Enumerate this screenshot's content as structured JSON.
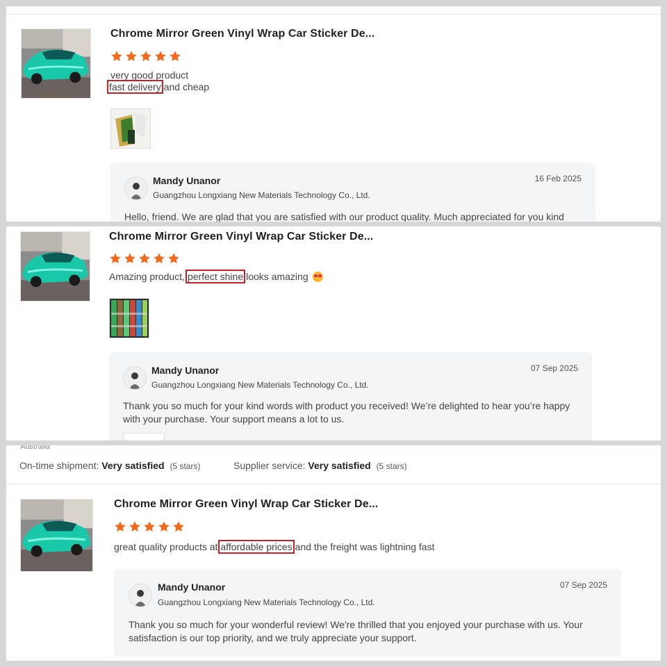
{
  "product_title": "Chrome Mirror Green Vinyl Wrap Car Sticker De...",
  "star_color": "#f26b1d",
  "highlight_color": "#c8202a",
  "reviews": [
    {
      "text_line1": "very good product",
      "text_highlight": "fast delivery",
      "text_after": "and cheap",
      "reply": {
        "name": "Mandy Unanor",
        "company": "Guangzhou Longxiang New Materials Technology Co., Ltd.",
        "date": "16 Feb 2025",
        "message": "Hello, friend. We are glad that you are satisfied with our product quality. Much appreciated for you kind"
      }
    },
    {
      "text_before": "Amazing product,",
      "text_highlight": "perfect shine",
      "text_after": "looks amazing",
      "emoji": "heart-eyes-emoji",
      "reply": {
        "name": "Mandy Unanor",
        "company": "Guangzhou Longxiang New Materials Technology Co., Ltd.",
        "date": "07 Sep 2025",
        "message": "Thank you so much for your kind words with product you received! We’re delighted to hear you’re happy with your purchase. Your support means a lot to us."
      }
    },
    {
      "text_before": "great quality products at",
      "text_highlight": "affordable prices",
      "text_after": "and the freight was lightning fast",
      "reply": {
        "name": "Mandy Unanor",
        "company": "Guangzhou Longxiang New Materials Technology Co., Ltd.",
        "date": "07 Sep 2025",
        "message": "Thank you so much for your wonderful review! We're thrilled that you enjoyed your purchase with us. Your satisfaction is our top priority, and we truly appreciate your support."
      }
    }
  ],
  "panel3_header": {
    "cutoff_text": "Australia",
    "shipment_label": "On-time shipment:",
    "shipment_value": "Very satisfied",
    "shipment_stars": "(5 stars)",
    "service_label": "Supplier service:",
    "service_value": "Very satisfied",
    "service_stars": "(5 stars)"
  }
}
